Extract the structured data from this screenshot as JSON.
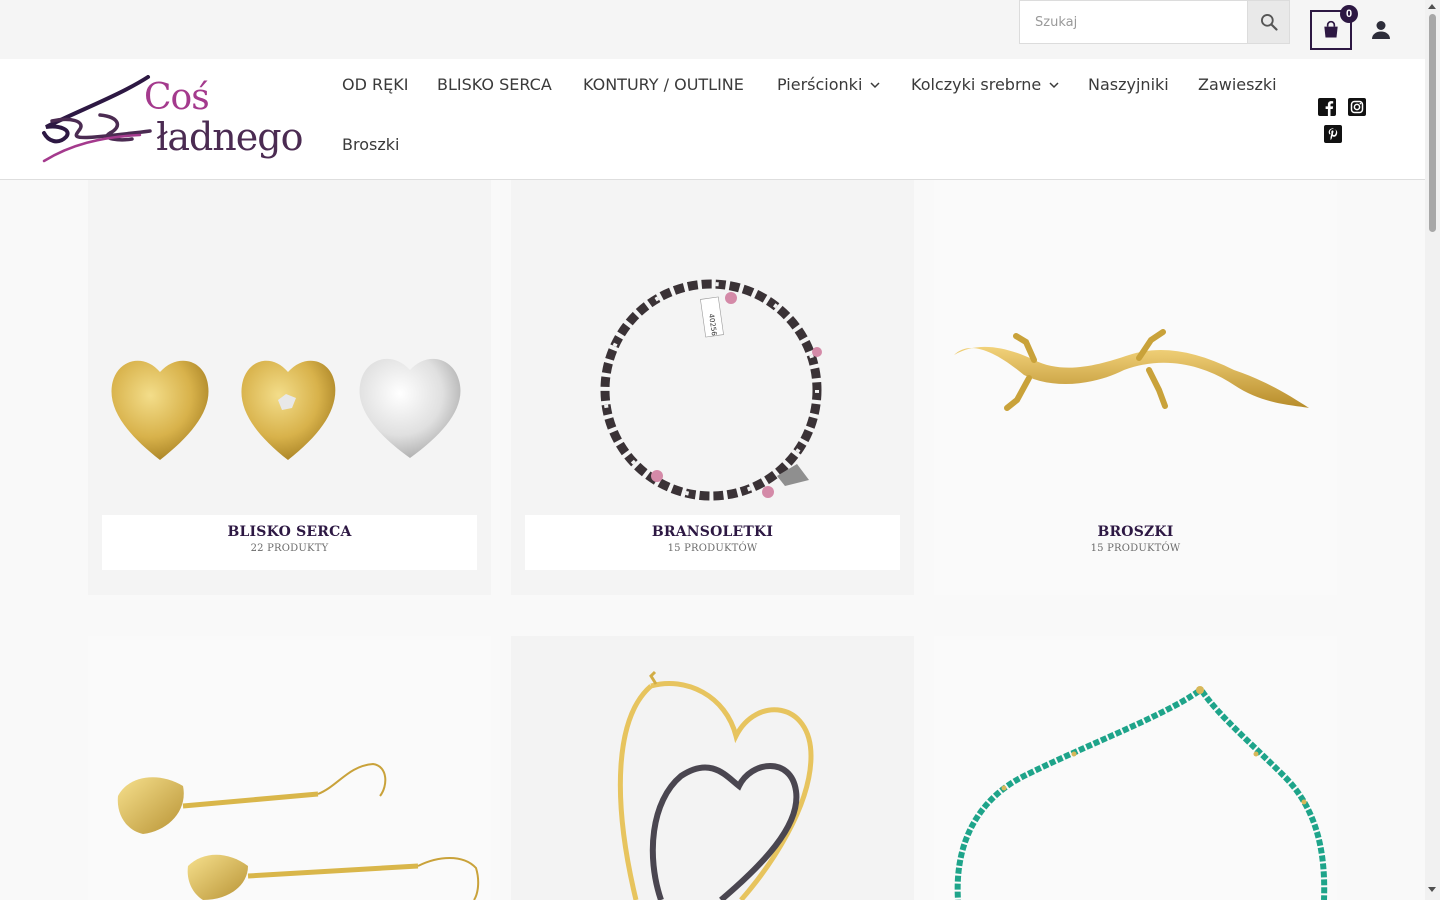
{
  "search": {
    "placeholder": "Szukaj"
  },
  "cart": {
    "count": "0"
  },
  "logo": {
    "line1": "Coś",
    "line2": "ładnego"
  },
  "nav": {
    "items": [
      {
        "label": "OD RĘKI"
      },
      {
        "label": "BLISKO SERCA"
      },
      {
        "label": "KONTURY / OUTLINE"
      },
      {
        "label": "Pierścionki"
      },
      {
        "label": "Kolczyki srebrne"
      },
      {
        "label": "Naszyjniki"
      },
      {
        "label": "Zawieszki"
      },
      {
        "label": "Broszki"
      }
    ]
  },
  "social": [
    "facebook-icon",
    "instagram-icon",
    "pinterest-icon"
  ],
  "categories": [
    {
      "title": "BLISKO SERCA",
      "count": "22 PRODUKTY"
    },
    {
      "title": "BRANSOLETKI",
      "count": "15 PRODUKTÓW"
    },
    {
      "title": "BROSZKI",
      "count": "15 PRODUKTÓW"
    }
  ],
  "colors": {
    "brand": "#2d1843",
    "accent": "#a43a8d"
  }
}
